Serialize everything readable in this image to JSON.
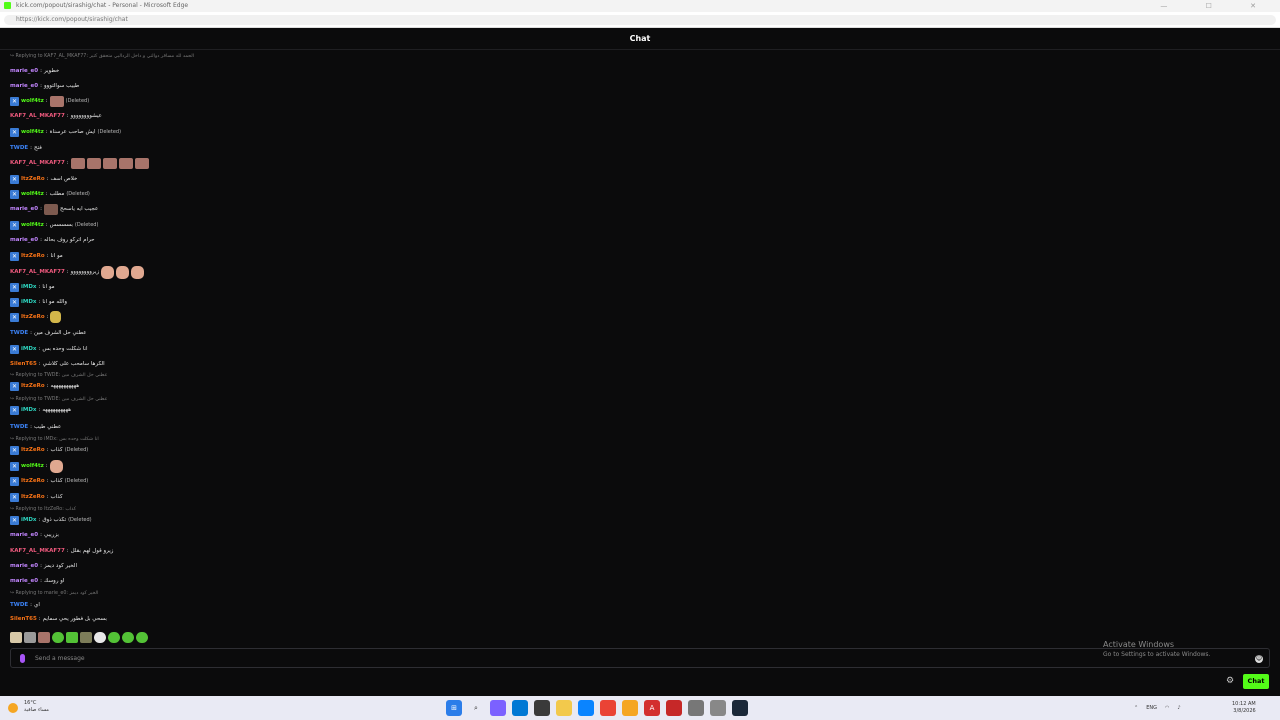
{
  "browser": {
    "window_title": "kick.com/popout/sirashig/chat - Personal - Microsoft Edge",
    "url": "https://kick.com/popout/sirashig/chat",
    "window_controls": "— ☐ ✕"
  },
  "chat": {
    "header_title": "Chat",
    "messages": [
      {
        "type": "reply",
        "text": "↪ Replying to KAF7_AL_MKAF77: الحمد لله مساقر دوالتي و داخل الرداليي متحقق كتير"
      },
      {
        "type": "msg",
        "user": "marie_e0",
        "color": "#c084fc",
        "badge": false,
        "text": "خطوير"
      },
      {
        "type": "msg",
        "user": "marie_e0",
        "color": "#c084fc",
        "badge": false,
        "text": "طييب سوالتووو"
      },
      {
        "type": "msg",
        "user": "wolf4tz",
        "color": "#53fc18",
        "badge": true,
        "text": "",
        "emote": "emote",
        "deleted": "(Deleted)"
      },
      {
        "type": "msg",
        "user": "KAF7_AL_MKAF77",
        "color": "#f05a7e",
        "badge": false,
        "text": "عيشوووووووو"
      },
      {
        "type": "msg",
        "user": "wolf4tz",
        "color": "#53fc18",
        "badge": true,
        "text": "ايش صاحب عرسناة",
        "deleted": "(Deleted)"
      },
      {
        "type": "msg",
        "user": "TWDE",
        "color": "#3b82f6",
        "badge": false,
        "text": "فتح"
      },
      {
        "type": "msg",
        "user": "KAF7_AL_MKAF77",
        "color": "#f05a7e",
        "badge": false,
        "text": "",
        "emotes5": true
      },
      {
        "type": "msg",
        "user": "ItzZeRo",
        "color": "#f97316",
        "badge": true,
        "text": "خلاص اسف"
      },
      {
        "type": "msg",
        "user": "wolf4tz",
        "color": "#53fc18",
        "badge": true,
        "text": "مطلب",
        "deleted": "(Deleted)"
      },
      {
        "type": "msg",
        "user": "marie_e0",
        "color": "#c084fc",
        "badge": false,
        "text": "عجيب ايه ياسحح",
        "emote": "emote dark"
      },
      {
        "type": "msg",
        "user": "wolf4tz",
        "color": "#53fc18",
        "badge": true,
        "text": "بسسسس",
        "deleted": "(Deleted)"
      },
      {
        "type": "msg",
        "user": "marie_e0",
        "color": "#c084fc",
        "badge": false,
        "text": "حرام اتركو روف بحاله"
      },
      {
        "type": "msg",
        "user": "ItzZeRo",
        "color": "#f97316",
        "badge": true,
        "text": "مو انا"
      },
      {
        "type": "msg",
        "user": "KAF7_AL_MKAF77",
        "color": "#f05a7e",
        "badge": false,
        "text": "زيروووووووو",
        "faces3": true
      },
      {
        "type": "msg",
        "user": "iMDx",
        "color": "#2dd4bf",
        "badge": true,
        "text": "مو انا"
      },
      {
        "type": "msg",
        "user": "iMDx",
        "color": "#2dd4bf",
        "badge": true,
        "text": "والله مو انا"
      },
      {
        "type": "msg",
        "user": "ItzZeRo",
        "color": "#f97316",
        "badge": true,
        "text": "",
        "emote": "emote bird"
      },
      {
        "type": "msg",
        "user": "TWDE",
        "color": "#3b82f6",
        "badge": false,
        "text": "عطني حل الشرف مين"
      },
      {
        "type": "msg",
        "user": "iMDx",
        "color": "#2dd4bf",
        "badge": true,
        "text": "انا شكلت وحده بس"
      },
      {
        "type": "msg",
        "user": "SilenT65",
        "color": "#f97316",
        "badge": false,
        "text": "الكرها سامحب على كلاشي"
      },
      {
        "type": "reply",
        "text": "↪ Replying to TWDE: عطني حل الشرف مين"
      },
      {
        "type": "msg",
        "user": "ItzZeRo",
        "color": "#f97316",
        "badge": true,
        "text": "ههههههههههه"
      },
      {
        "type": "reply",
        "text": "↪ Replying to TWDE: عطني حل الشرف مين"
      },
      {
        "type": "msg",
        "user": "iMDx",
        "color": "#2dd4bf",
        "badge": true,
        "text": "ههههههههههه"
      },
      {
        "type": "msg",
        "user": "TWDE",
        "color": "#3b82f6",
        "badge": false,
        "text": "عطني طيب"
      },
      {
        "type": "reply",
        "text": "↪ Replying to iMDx: انا شكلت وحده بس"
      },
      {
        "type": "msg",
        "user": "ItzZeRo",
        "color": "#f97316",
        "badge": true,
        "text": "كذاب",
        "deleted": "(Deleted)"
      },
      {
        "type": "msg",
        "user": "wolf4tz",
        "color": "#53fc18",
        "badge": true,
        "text": "",
        "emote": "emote face"
      },
      {
        "type": "msg",
        "user": "ItzZeRo",
        "color": "#f97316",
        "badge": true,
        "text": "كذاب",
        "deleted": "(Deleted)"
      },
      {
        "type": "msg",
        "user": "ItzZeRo",
        "color": "#f97316",
        "badge": true,
        "text": "كذاب"
      },
      {
        "type": "reply",
        "text": "↪ Replying to ItzZeRo: كذاب"
      },
      {
        "type": "msg",
        "user": "iMDx",
        "color": "#2dd4bf",
        "badge": true,
        "text": "تكذب ذوق",
        "deleted": "(Deleted)"
      },
      {
        "type": "msg",
        "user": "marie_e0",
        "color": "#c084fc",
        "badge": false,
        "text": "بزريبي"
      },
      {
        "type": "msg",
        "user": "KAF7_AL_MKAF77",
        "color": "#f05a7e",
        "badge": false,
        "text": "زيرو قول لهم بقلل"
      },
      {
        "type": "msg",
        "user": "marie_e0",
        "color": "#c084fc",
        "badge": false,
        "text": "الخير كود ديمز"
      },
      {
        "type": "msg",
        "user": "marie_e0",
        "color": "#c084fc",
        "badge": false,
        "text": "او روسك"
      },
      {
        "type": "reply",
        "text": "↪ Replying to marie_e0: الخير كود ديمز"
      },
      {
        "type": "msg",
        "user": "TWDE",
        "color": "#3b82f6",
        "badge": false,
        "text": "اي"
      },
      {
        "type": "msg",
        "user": "SilenT65",
        "color": "#f97316",
        "badge": false,
        "text": "بسحي بل فطور يحي سمايم"
      }
    ],
    "input_placeholder": "Send a message",
    "send_label": "Chat"
  },
  "windows_watermark": {
    "title": "Activate Windows",
    "subtitle": "Go to Settings to activate Windows."
  },
  "taskbar": {
    "weather_temp": "16°C",
    "weather_desc": "مساء صافية",
    "tray_lang": "ENG",
    "time": "10:12 AM",
    "date": "3/8/2026"
  }
}
